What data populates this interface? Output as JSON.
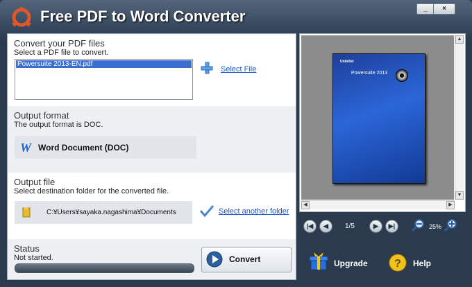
{
  "window": {
    "title": "Free PDF to Word Converter",
    "minimize_glyph": "_",
    "close_glyph": "×"
  },
  "convert_section": {
    "heading": "Convert your PDF files",
    "subtitle": "Select a PDF file to convert.",
    "files": [
      "Powersuite 2013-EN.pdf"
    ],
    "select_file_label": "Select File"
  },
  "output_format": {
    "heading": "Output format",
    "subtitle": "The output format is DOC.",
    "format_label": "Word Document (DOC)"
  },
  "output_file": {
    "heading": "Output file",
    "subtitle": "Select destination folder for the converted file.",
    "folder_path": "C:¥Users¥sayaka.nagashima¥Documents",
    "select_folder_label": "Select another folder"
  },
  "status": {
    "heading": "Status",
    "text": "Not started.",
    "progress": 0,
    "convert_label": "Convert"
  },
  "preview": {
    "thumb_brand": "Unibllist",
    "thumb_title": "Powersuite 2013",
    "page_counter": "1/5",
    "zoom_level": "25%"
  },
  "footer": {
    "upgrade_label": "Upgrade",
    "help_label": "Help"
  },
  "colors": {
    "link": "#1a56c8",
    "selection": "#3a6fd0",
    "page_blue": "#2b66d8"
  },
  "icons": [
    "app-logo-icon",
    "plus-icon",
    "word-icon",
    "folder-icon",
    "check-icon",
    "play-icon",
    "first-page-icon",
    "prev-page-icon",
    "next-page-icon",
    "last-page-icon",
    "zoom-out-icon",
    "zoom-in-icon",
    "gift-icon",
    "help-icon"
  ]
}
